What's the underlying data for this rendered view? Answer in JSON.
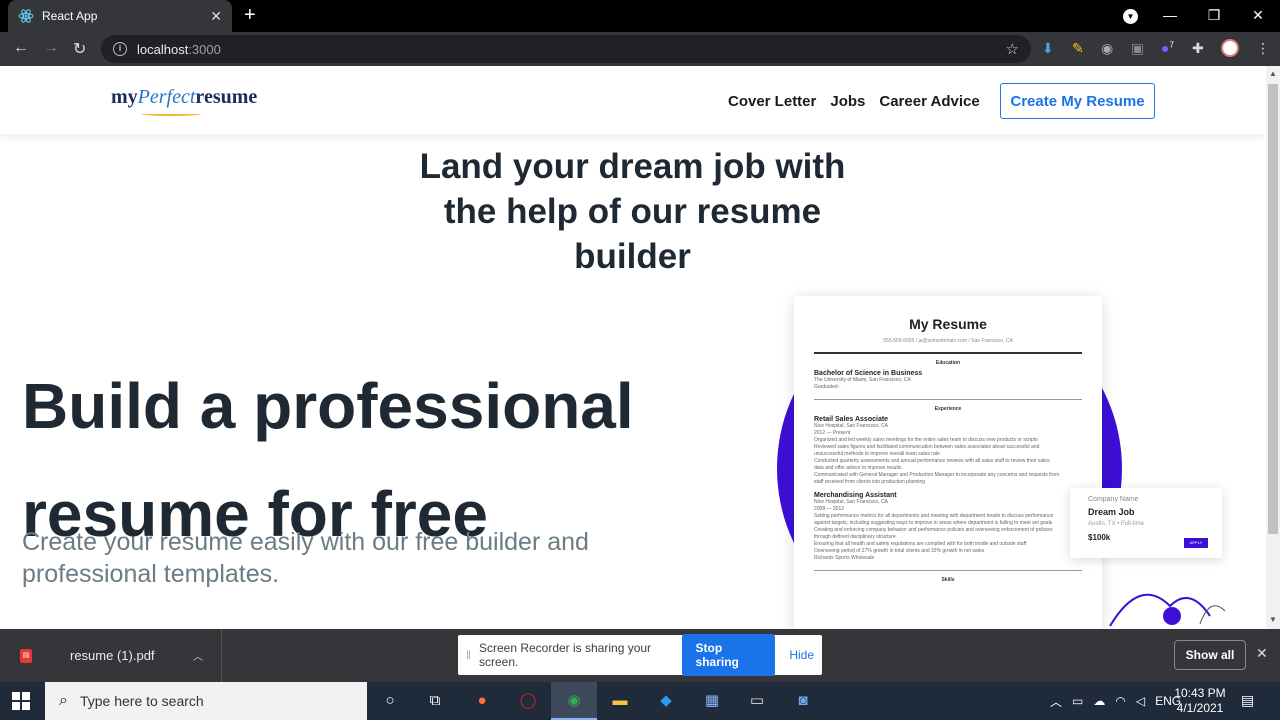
{
  "browser": {
    "tab_title": "React App",
    "url_host": "localhost",
    "url_port": ":3000",
    "extension_badge": "7"
  },
  "site": {
    "logo_my": "my",
    "logo_perfect": "Perfect",
    "logo_resume": "resume",
    "nav": [
      "Cover Letter",
      "Jobs",
      "Career Advice"
    ],
    "cta": "Create My Resume",
    "hero_top": "Land your dream job with the help of our resume builder",
    "hero_big": "Build a professional resume for free",
    "hero_sub": "Create your resume easily with our free builder and professional templates."
  },
  "resume_preview": {
    "title": "My Resume",
    "contact": "555-555-5555 / ja@somedomain.com / San Francisco, CA",
    "education_label": "Education",
    "degree": "Bachelor of Science in Business",
    "school": "The University of Miami, San Francisco, CA",
    "graduated": "Graduated -",
    "experience_label": "Experience",
    "job1_title": "Retail Sales Associate",
    "job1_company": "Nice Hospital, San Francisco, CA",
    "job1_dates": "2012 — Present",
    "job1_lines": [
      "Organized and led weekly sales meetings for the entire sales team to discuss new products or scripts",
      "Reviewed sales figures and facilitated communication between sales associates about successful and",
      "unsuccessful methods to improve overall team sales rate",
      "Conducted quarterly assessments and annual performance reviews with all sales staff to review their sales",
      "data and offer advice to improve results",
      "Communicated with General Manager and Production Manager to incorporate any concerns and requests from",
      "staff received from clients into production planning"
    ],
    "job2_title": "Merchandising Assistant",
    "job2_company": "Nice Hospital, San Francisco, CA",
    "job2_dates": "2008 — 2012",
    "job2_lines": [
      "Setting performance metrics for all departments and meeting with department heads to discuss performance",
      "against targets, including suggesting ways to improve in areas where department is failing to meet set goals",
      "Creating and enforcing company behavior and performance policies and overseeing enforcement of policies",
      "through defined disciplinary structure",
      "Ensuring that all health and safety regulations are complied with for both inside and outside staff",
      "Overseeing period of 27% growth in total clients and 32% growth in net sales",
      "Richards Sports Wholesale"
    ],
    "skills_label": "Skills"
  },
  "job_card": {
    "company": "Company Name",
    "title": "Dream Job",
    "location": "Austin, TX • Full-time",
    "pay": "$100k",
    "apply": "APPLY"
  },
  "download_bar": {
    "file": "resume (1).pdf",
    "share_text": "Screen Recorder is sharing your screen.",
    "stop": "Stop sharing",
    "hide": "Hide",
    "show_all": "Show all"
  },
  "taskbar": {
    "search_placeholder": "Type here to search",
    "lang": "ENG",
    "time": "10:43 PM",
    "date": "4/1/2021"
  }
}
